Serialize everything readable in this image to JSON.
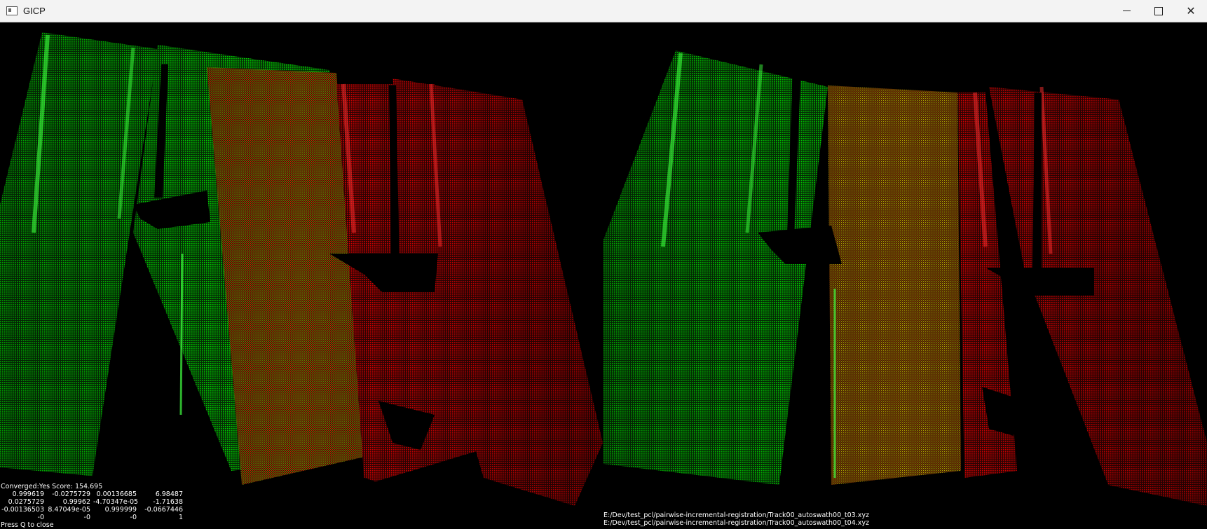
{
  "window": {
    "title": "GICP"
  },
  "controls": {
    "minimize": "minimize",
    "maximize": "maximize",
    "close": "close"
  },
  "colors": {
    "target_cloud": "#00d200",
    "source_cloud": "#e00000",
    "background": "#000000"
  },
  "status": {
    "converged_line": "Converged:Yes Score: 154.695",
    "matrix": [
      [
        "0.999619",
        "-0.0275729",
        "0.00136685",
        "6.98487"
      ],
      [
        "0.0275729",
        "0.99962",
        "-4.70347e-05",
        "-1.71638"
      ],
      [
        "-0.00136503",
        "8.47049e-05",
        "0.999999",
        "-0.0667446"
      ],
      [
        "-0",
        "-0",
        "-0",
        "1"
      ]
    ],
    "hint": "Press Q to close"
  },
  "files": {
    "file1": "E:/Dev/test_pcl/pairwise-incremental-registration/Track00_autoswath00_t03.xyz",
    "file2": "E:/Dev/test_pcl/pairwise-incremental-registration/Track00_autoswath00_t04.xyz"
  }
}
